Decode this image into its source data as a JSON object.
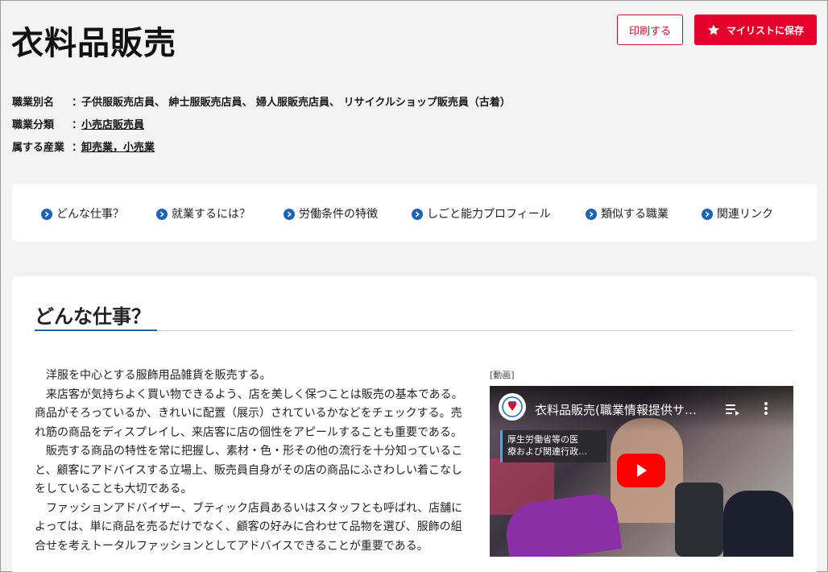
{
  "page": {
    "title": "衣料品販売",
    "print_label": "印刷する",
    "save_label": "マイリストに保存"
  },
  "meta": {
    "aliases_label": "職業別名",
    "aliases_sep": "：",
    "aliases_value": "子供服販売店員、 紳士服販売店員、 婦人服販売店員、 リサイクルショップ販売員（古着）",
    "category_label": "職業分類",
    "category_sep": "：",
    "category_value": "小売店販売員",
    "industry_label": "属する産業",
    "industry_sep": "：",
    "industry_value": "卸売業，小売業"
  },
  "nav": {
    "items": [
      {
        "label": "どんな仕事？"
      },
      {
        "label": "就業するには？"
      },
      {
        "label": "労働条件の特徴"
      },
      {
        "label": "しごと能力プロフィール"
      },
      {
        "label": "類似する職業"
      },
      {
        "label": "関連リンク"
      }
    ]
  },
  "section": {
    "heading": "どんな仕事？",
    "paragraphs": [
      "洋服を中心とする服飾用品雑貨を販売する。",
      "来店客が気持ちよく買い物できるよう、店を美しく保つことは販売の基本である。商品がそろっているか、きれいに配置（展示）されているかなどをチェックする。売れ筋の商品をディスプレイし、来店客に店の個性をアピールすることも重要である。",
      "販売する商品の特性を常に把握し、素材・色・形その他の流行を十分知っていること、顧客にアドバイスする立場上、販売員自身がその店の商品にふさわしい着こなしをしていることも大切である。",
      "ファッションアドバイザー、ブティック店員あるいはスタッフとも呼ばれ、店舗によっては、単に商品を売るだけでなく、顧客の好みに合わせて品物を選び、服飾の組合せを考えトータルファッションとしてアドバイスできることが重要である。"
    ]
  },
  "video": {
    "label": "[動画]",
    "title": "衣料品販売(職業情報提供サ…",
    "card_line1": "厚生労働省等の医",
    "card_line2": "療および関連行政…",
    "channel_logo_icon": "mhlw-logo-icon",
    "play_color": "#ff0000"
  },
  "colors": {
    "accent_red": "#e5002b",
    "nav_blue": "#1d63b8"
  }
}
